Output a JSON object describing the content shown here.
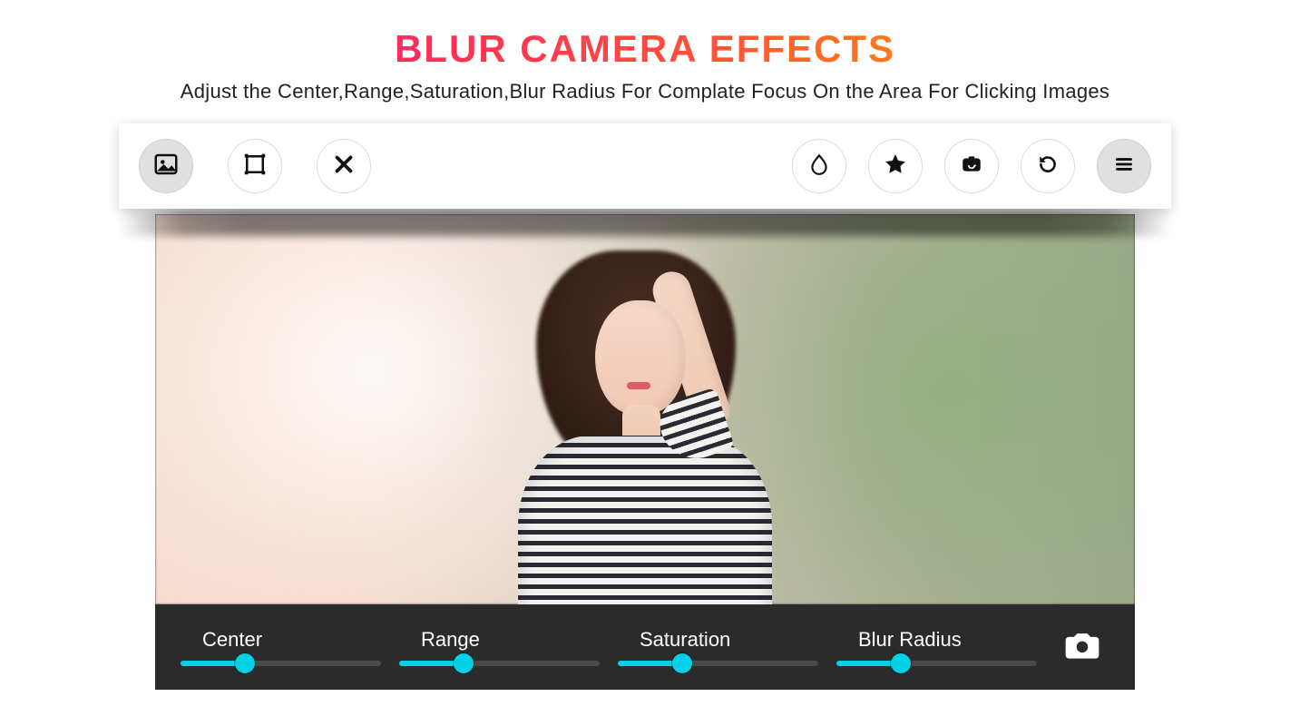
{
  "heading": {
    "title": "BLUR CAMERA EFFECTS",
    "subtitle": "Adjust the Center,Range,Saturation,Blur Radius For Complate Focus On the Area For Clicking Images"
  },
  "toolbar": {
    "left": [
      {
        "name": "gallery-icon"
      },
      {
        "name": "crop-icon"
      },
      {
        "name": "close-icon"
      }
    ],
    "right": [
      {
        "name": "drop-icon"
      },
      {
        "name": "star-icon"
      },
      {
        "name": "camera-switch-icon"
      },
      {
        "name": "refresh-icon"
      },
      {
        "name": "menu-icon"
      }
    ]
  },
  "sliders": [
    {
      "label": "Center",
      "value": 32
    },
    {
      "label": "Range",
      "value": 32
    },
    {
      "label": "Saturation",
      "value": 32
    },
    {
      "label": "Blur Radius",
      "value": 32
    }
  ],
  "colors": {
    "accent": "#00d1e6",
    "title_gradient_from": "#ff2a5e",
    "title_gradient_to": "#ff7a1a",
    "sliderbar_bg": "#2b2b2b"
  },
  "capture_button": {
    "name": "capture-icon"
  }
}
